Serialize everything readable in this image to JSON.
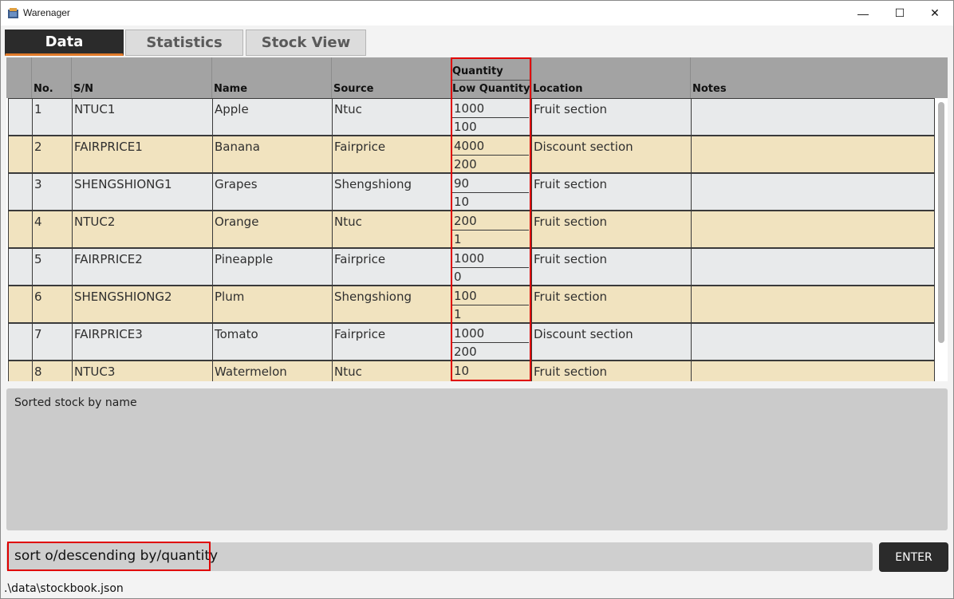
{
  "window": {
    "title": "Warenager",
    "icon": "box-app-icon",
    "minimize_glyph": "—",
    "maximize_glyph": "☐",
    "close_glyph": "✕"
  },
  "tabs": [
    {
      "label": "Data",
      "selected": true
    },
    {
      "label": "Statistics",
      "selected": false
    },
    {
      "label": "Stock View",
      "selected": false
    }
  ],
  "table": {
    "headers": {
      "no": "No.",
      "sn": "S/N",
      "name": "Name",
      "source": "Source",
      "quantity": "Quantity",
      "low_quantity": "Low Quantity",
      "location": "Location",
      "notes": "Notes"
    },
    "rows": [
      {
        "no": "1",
        "sn": "NTUC1",
        "name": "Apple",
        "source": "Ntuc",
        "quantity": "1000",
        "low_quantity": "100",
        "location": "Fruit section",
        "notes": ""
      },
      {
        "no": "2",
        "sn": "FAIRPRICE1",
        "name": "Banana",
        "source": "Fairprice",
        "quantity": "4000",
        "low_quantity": "200",
        "location": "Discount section",
        "notes": ""
      },
      {
        "no": "3",
        "sn": "SHENGSHIONG1",
        "name": "Grapes",
        "source": "Shengshiong",
        "quantity": "90",
        "low_quantity": "10",
        "location": "Fruit section",
        "notes": ""
      },
      {
        "no": "4",
        "sn": "NTUC2",
        "name": "Orange",
        "source": "Ntuc",
        "quantity": "200",
        "low_quantity": "1",
        "location": "Fruit section",
        "notes": ""
      },
      {
        "no": "5",
        "sn": "FAIRPRICE2",
        "name": "Pineapple",
        "source": "Fairprice",
        "quantity": "1000",
        "low_quantity": "0",
        "location": "Fruit section",
        "notes": ""
      },
      {
        "no": "6",
        "sn": "SHENGSHIONG2",
        "name": "Plum",
        "source": "Shengshiong",
        "quantity": "100",
        "low_quantity": "1",
        "location": "Fruit section",
        "notes": ""
      },
      {
        "no": "7",
        "sn": "FAIRPRICE3",
        "name": "Tomato",
        "source": "Fairprice",
        "quantity": "1000",
        "low_quantity": "200",
        "location": "Discount section",
        "notes": ""
      },
      {
        "no": "8",
        "sn": "NTUC3",
        "name": "Watermelon",
        "source": "Ntuc",
        "quantity": "10",
        "low_quantity": "",
        "location": "Fruit section",
        "notes": ""
      }
    ]
  },
  "result_display": {
    "text": "Sorted stock by name"
  },
  "command_box": {
    "value": "sort o/descending by/quantity",
    "button_label": "ENTER"
  },
  "status_bar": {
    "file_path": ".\\data\\stockbook.json"
  },
  "colors": {
    "highlight": "#e00000",
    "row_odd": "#e8eaeb",
    "row_even": "#f1e3bf",
    "header_bg": "#a3a3a3",
    "tab_active": "#2b2b2b",
    "tab_accent": "#e07a2a"
  }
}
